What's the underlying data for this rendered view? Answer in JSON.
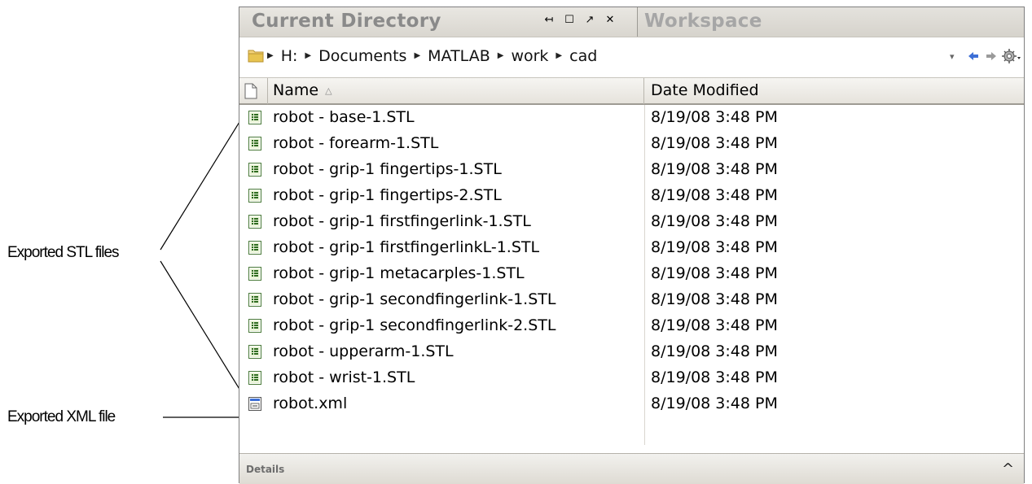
{
  "annotations": {
    "stl_label": "Exported STL files",
    "xml_label": "Exported XML file"
  },
  "tabs": {
    "active_label": "Current Directory",
    "inactive_label": "Workspace",
    "controls": {
      "undock": "↤",
      "maximize": "☐",
      "restore": "↗",
      "close": "✕"
    }
  },
  "address": {
    "crumbs": [
      "H:",
      "Documents",
      "MATLAB",
      "work",
      "cad"
    ],
    "dropdown_glyph": "▾",
    "back_glyph": "◆",
    "forward_glyph": "➡",
    "settings_glyph": "⚙▾"
  },
  "columns": {
    "name": "Name",
    "sort_indicator": "△",
    "date": "Date Modified"
  },
  "files": [
    {
      "name": "robot - base-1.STL",
      "date": "8/19/08 3:48 PM",
      "icon": "stl-file-icon"
    },
    {
      "name": "robot - forearm-1.STL",
      "date": "8/19/08 3:48 PM",
      "icon": "stl-file-icon"
    },
    {
      "name": "robot - grip-1 fingertips-1.STL",
      "date": "8/19/08 3:48 PM",
      "icon": "stl-file-icon"
    },
    {
      "name": "robot - grip-1 fingertips-2.STL",
      "date": "8/19/08 3:48 PM",
      "icon": "stl-file-icon"
    },
    {
      "name": "robot - grip-1 firstfingerlink-1.STL",
      "date": "8/19/08 3:48 PM",
      "icon": "stl-file-icon"
    },
    {
      "name": "robot - grip-1 firstfingerlinkL-1.STL",
      "date": "8/19/08 3:48 PM",
      "icon": "stl-file-icon"
    },
    {
      "name": "robot - grip-1 metacarples-1.STL",
      "date": "8/19/08 3:48 PM",
      "icon": "stl-file-icon"
    },
    {
      "name": "robot - grip-1 secondfingerlink-1.STL",
      "date": "8/19/08 3:48 PM",
      "icon": "stl-file-icon"
    },
    {
      "name": "robot - grip-1 secondfingerlink-2.STL",
      "date": "8/19/08 3:48 PM",
      "icon": "stl-file-icon"
    },
    {
      "name": "robot - upperarm-1.STL",
      "date": "8/19/08 3:48 PM",
      "icon": "stl-file-icon"
    },
    {
      "name": "robot - wrist-1.STL",
      "date": "8/19/08 3:48 PM",
      "icon": "stl-file-icon"
    },
    {
      "name": "robot.xml",
      "date": "8/19/08 3:48 PM",
      "icon": "xml-file-icon"
    }
  ],
  "details": {
    "label": "Details",
    "toggle_glyph": "^"
  },
  "colors": {
    "tab_text_active": "#8a8a8a",
    "tab_text_inactive": "#a6a6a6",
    "arrow_blue": "#3d6fd6",
    "folder_yellow": "#e8c450"
  }
}
